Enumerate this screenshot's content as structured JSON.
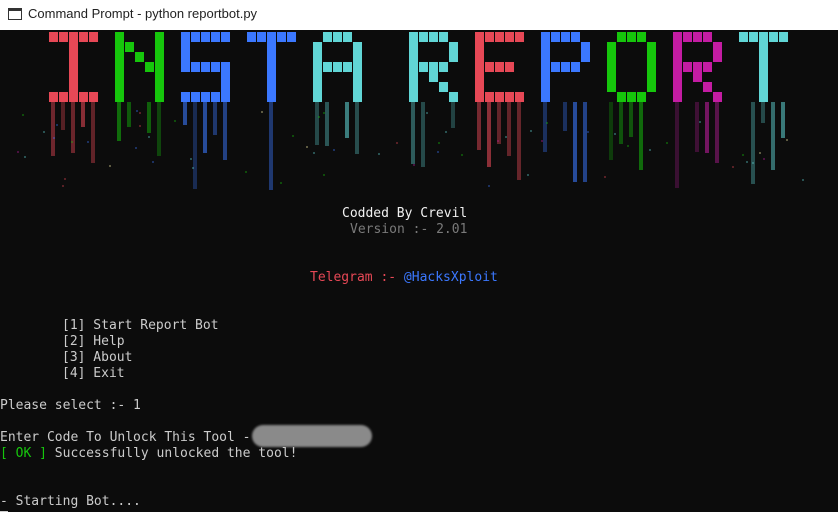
{
  "window": {
    "title": "Command Prompt - python  reportbot.py"
  },
  "banner": {
    "text": "INSTA REPORT",
    "letter_colors": [
      "#e74856",
      "#16c60c",
      "#3b78ff",
      "#3b78ff",
      "#61d6d6",
      "#61d6d6",
      "#e74856",
      "#3b78ff",
      "#16c60c",
      "#c41ca3",
      "#61d6d6",
      "#f9f1a5"
    ]
  },
  "header": {
    "credit": "Codded By Crevil",
    "version": "Version :- 2.01",
    "telegram_label": "Telegram :-",
    "telegram_handle": "@HacksXploit"
  },
  "menu": {
    "items": [
      "[1] Start Report Bot",
      "[2] Help",
      "[3] About",
      "[4] Exit"
    ]
  },
  "prompts": {
    "select": "Please select :- 1",
    "unlock": "Enter Code To Unlock This Tool -",
    "ok_tag": "[ OK ]",
    "ok_message": "Successfully unlocked the tool!",
    "starting": "- Starting Bot...."
  }
}
